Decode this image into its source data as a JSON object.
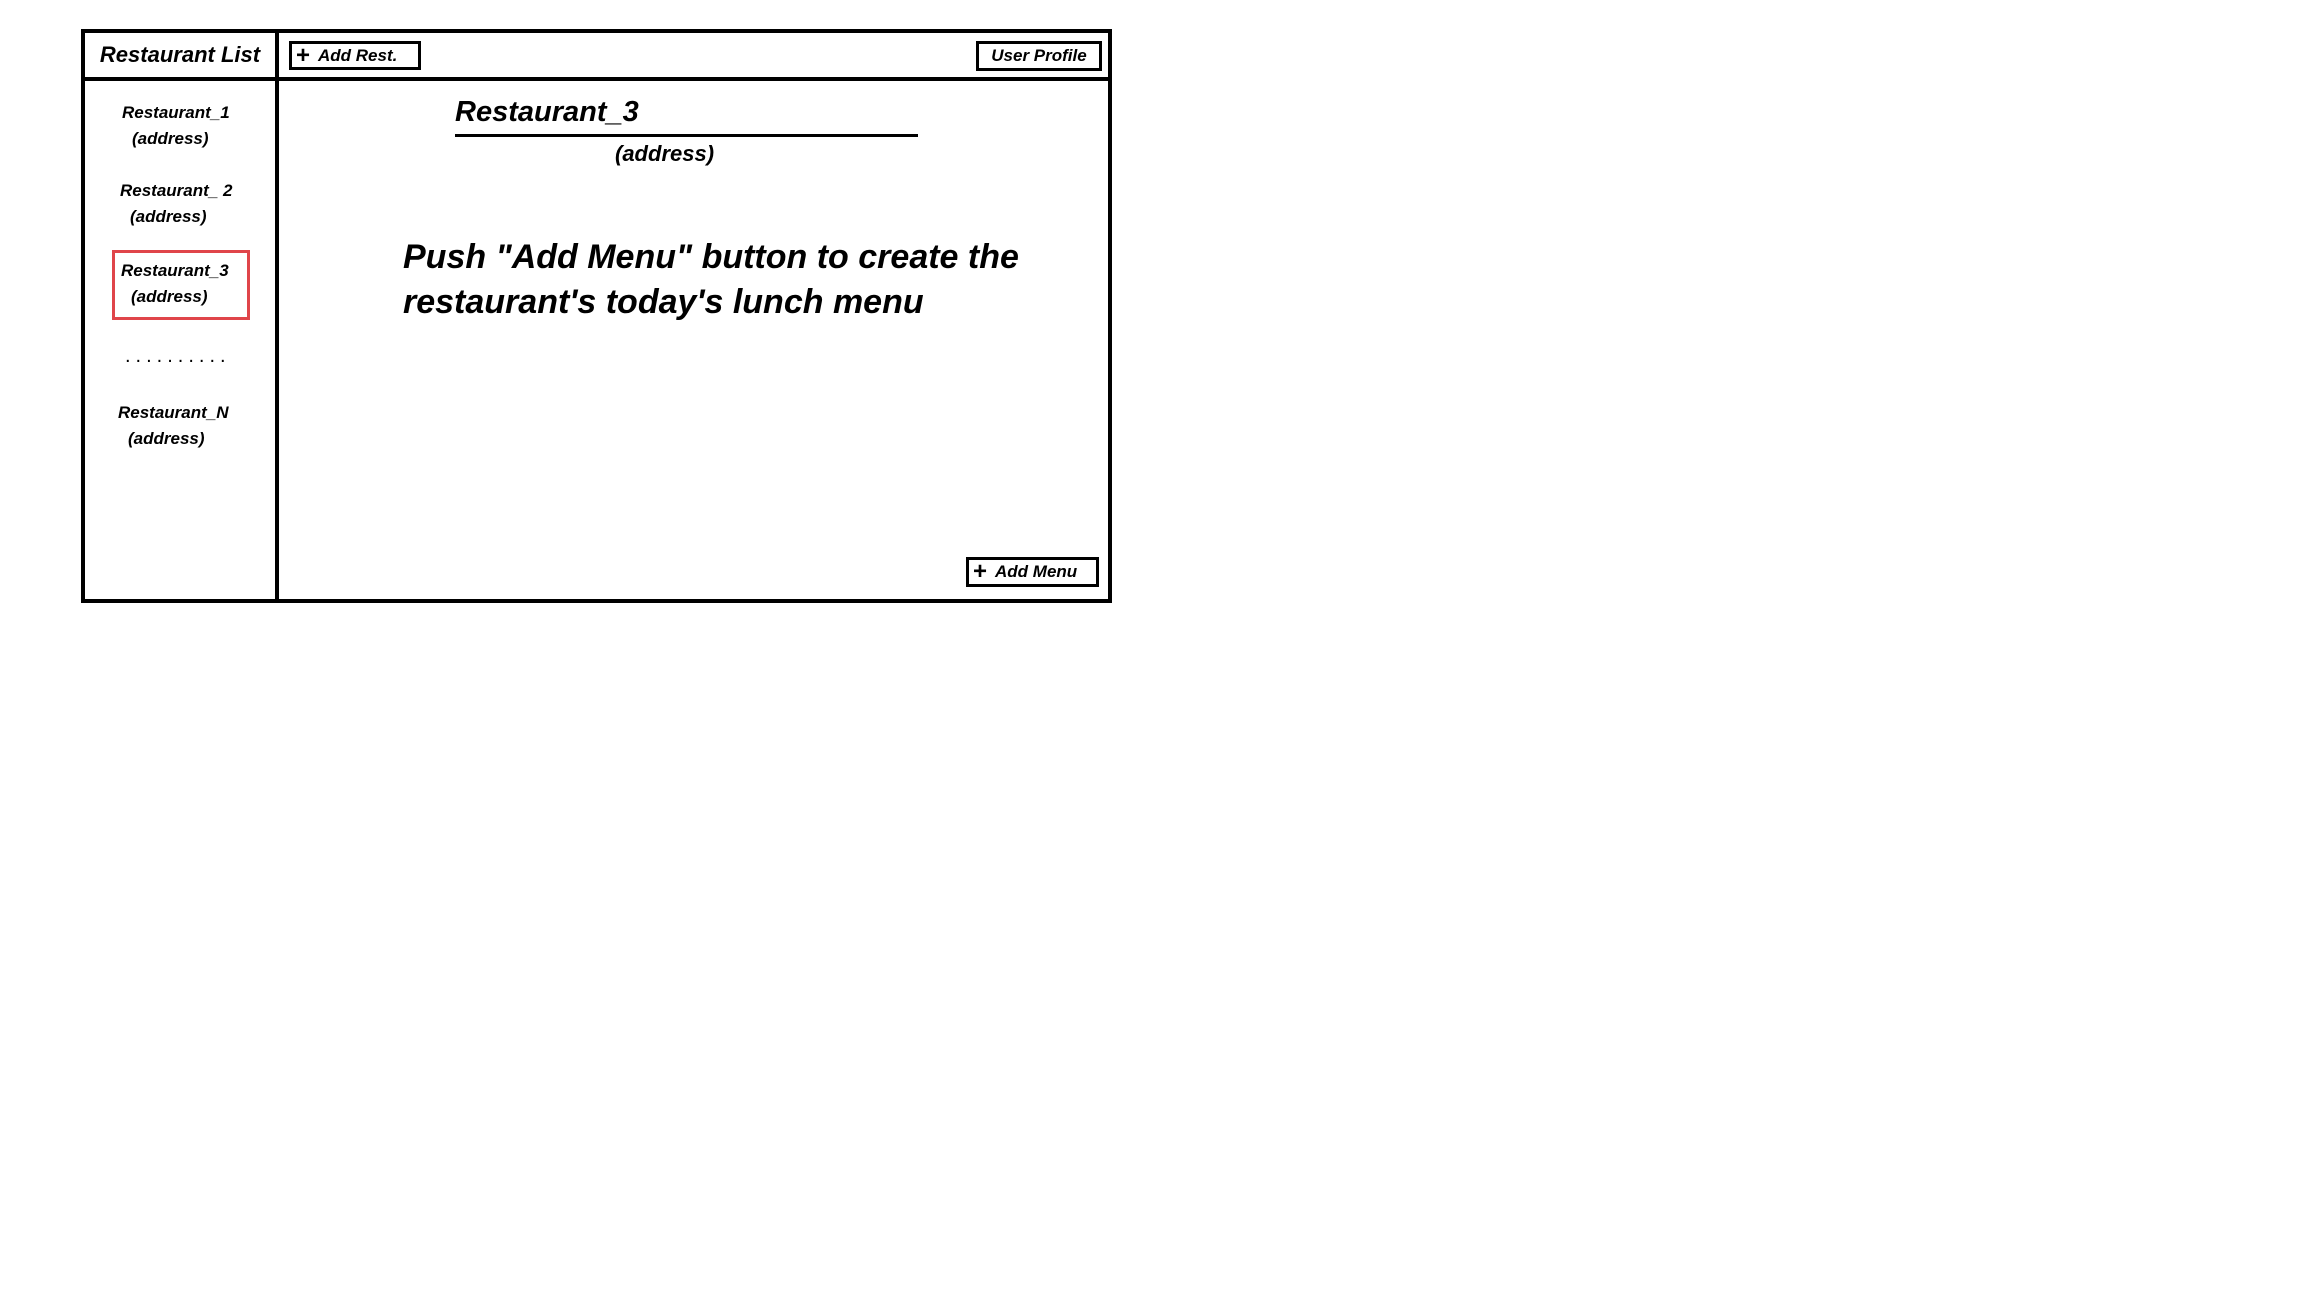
{
  "sidebar": {
    "title": "Restaurant List",
    "items": [
      {
        "name": "Restaurant_1",
        "address": "(address)"
      },
      {
        "name": "Restaurant_ 2",
        "address": "(address)"
      },
      {
        "name": "Restaurant_3",
        "address": "(address)"
      },
      {
        "name": "Restaurant_N",
        "address": "(address)"
      }
    ],
    "ellipsis": ".........."
  },
  "toolbar": {
    "add_rest_label": "Add Rest.",
    "user_profile_label": "User Profile"
  },
  "detail": {
    "title": "Restaurant_3",
    "address": "(address)",
    "instruction": "Push \"Add Menu\" button to create the restaurant's today's lunch menu",
    "add_menu_label": "Add Menu"
  },
  "colors": {
    "selected_border": "#e0454a"
  }
}
